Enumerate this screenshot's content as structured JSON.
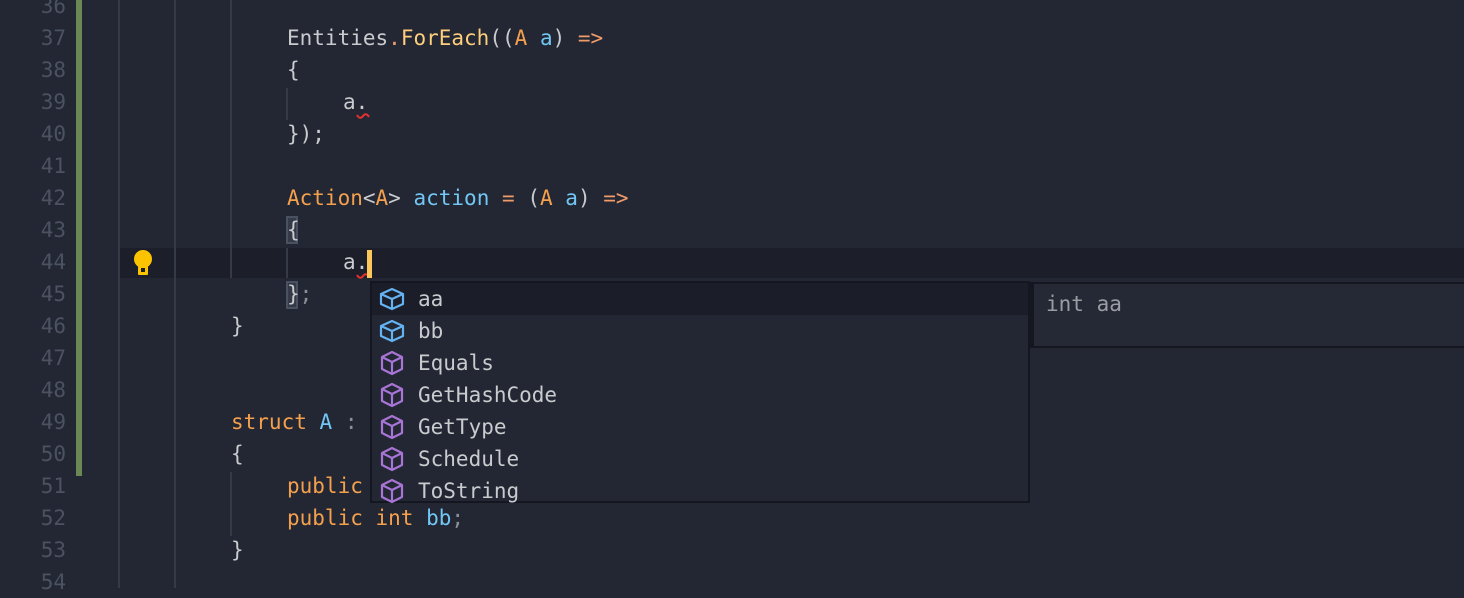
{
  "editor": {
    "line_numbers": [
      "36",
      "37",
      "38",
      "39",
      "40",
      "41",
      "42",
      "43",
      "44",
      "45",
      "46",
      "47",
      "48",
      "49",
      "50",
      "51",
      "52",
      "53",
      "54"
    ],
    "current_line": "44",
    "code": {
      "l37": {
        "entities": "Entities",
        "dot": ".",
        "method": "ForEach",
        "open": "((",
        "type": "A",
        "param": "a",
        "close": ")",
        "arrow": "=>"
      },
      "l38": "{",
      "l39": "a.",
      "l40": "});",
      "l42": {
        "type": "Action",
        "lt": "<",
        "targ": "A",
        "gt": ">",
        "var": "action",
        "eq": "=",
        "open": "(",
        "ptype": "A",
        "param": "a",
        "close": ")",
        "arrow": "=>"
      },
      "l43": "{",
      "l44": "a.",
      "l45_brace": "}",
      "l45_semi": ";",
      "l46": "}",
      "l49": {
        "kw": "struct",
        "name": "A",
        "colon": ":"
      },
      "l50": "{",
      "l51": {
        "kw": "public"
      },
      "l52": {
        "kw": "public",
        "type": "int",
        "name": "bb",
        "semi": ";"
      },
      "l53": "}"
    }
  },
  "completion": {
    "items": [
      {
        "label": "aa",
        "icon": "field-icon",
        "selected": true
      },
      {
        "label": "bb",
        "icon": "field-icon"
      },
      {
        "label": "Equals",
        "icon": "method-icon"
      },
      {
        "label": "GetHashCode",
        "icon": "method-icon"
      },
      {
        "label": "GetType",
        "icon": "method-icon"
      },
      {
        "label": "Schedule",
        "icon": "method-icon"
      },
      {
        "label": "ToString",
        "icon": "method-icon"
      }
    ],
    "detail": "int aa"
  },
  "colors": {
    "background": "#222733",
    "keyword": "#f5a04d",
    "method": "#fdce7b",
    "identifier": "#72c7f5",
    "operator": "#f09b69",
    "field_icon": "#64b2f2",
    "method_icon": "#a874d6",
    "caret": "#fbc75a",
    "lightbulb": "#fcc400",
    "change_bar": "#6b8754",
    "error": "#e33131"
  }
}
